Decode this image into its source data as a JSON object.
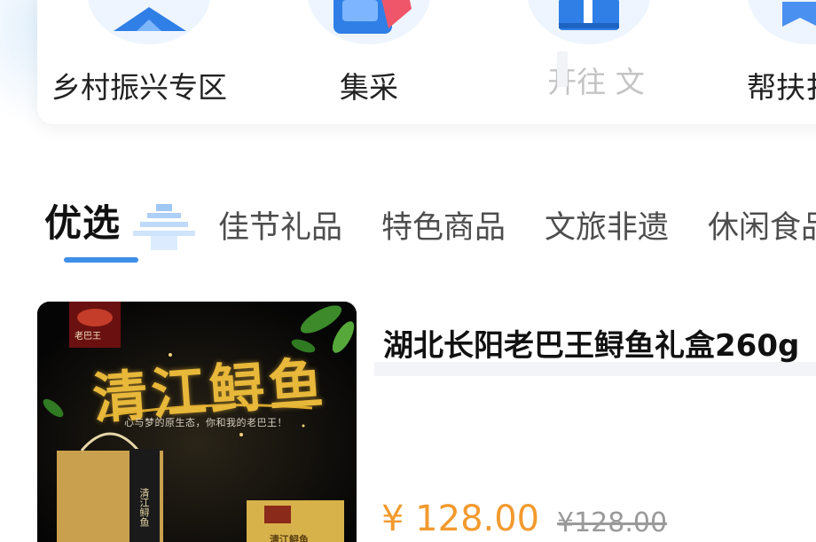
{
  "categories": [
    {
      "label": "乡村振兴专区",
      "icon": "rural-revitalization-icon"
    },
    {
      "label": "集采",
      "icon": "group-purchase-icon"
    },
    {
      "label": "开往 文",
      "icon": "gift-box-icon"
    },
    {
      "label": "帮扶扌",
      "icon": "bookmark-icon"
    }
  ],
  "tabs": {
    "active": "优选",
    "items": [
      "佳节礼品",
      "特色商品",
      "文旅非遗",
      "休闲食品"
    ]
  },
  "product": {
    "title": "湖北长阳老巴王鲟鱼礼盒260g",
    "price": "¥ 128.00",
    "original_price": "¥128.00",
    "image": {
      "title": "清江鲟鱼",
      "slogan": "心与梦的原生态，你和我的老巴王！",
      "brand": "老巴王",
      "bag_text": "清江鲟鱼",
      "box_text": "清江鲟鱼"
    }
  },
  "colors": {
    "accent": "#3f8ee8",
    "price": "#f29a2e",
    "icon_bg": "#eef5fe"
  }
}
